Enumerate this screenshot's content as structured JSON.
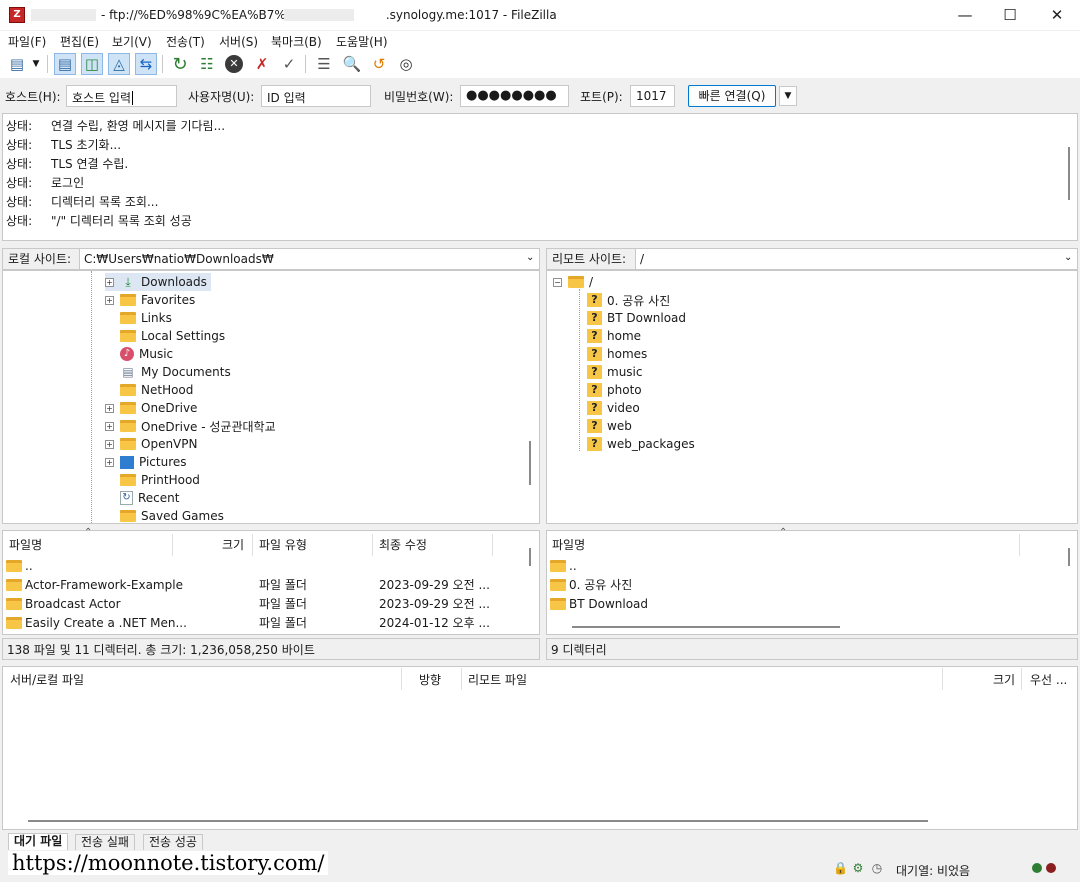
{
  "window": {
    "title": "- ftp://%ED%98%9C%EA%B7%9C@",
    "title_suffix": ".synology.me:1017 - FileZilla",
    "minimize_icon": "minimize-icon",
    "maximize_icon": "maximize-icon",
    "close_icon": "close-icon"
  },
  "menu": [
    "파일(F)",
    "편집(E)",
    "보기(V)",
    "전송(T)",
    "서버(S)",
    "북마크(B)",
    "도움말(H)"
  ],
  "toolbar_icons": [
    "site-manager-icon",
    "dropdown-icon",
    "toggle-log-icon",
    "toggle-local-tree-icon",
    "toggle-remote-tree-icon",
    "toggle-queue-icon",
    "refresh-icon",
    "process-queue-icon",
    "cancel-icon",
    "disconnect-icon",
    "reconnect-icon",
    "filter-icon",
    "compare-icon",
    "sync-browse-icon",
    "search-icon"
  ],
  "quickconnect": {
    "host_label": "호스트(H):",
    "host_value": "호스트 입력",
    "user_label": "사용자명(U):",
    "user_value": "ID 입력",
    "pass_label": "비밀번호(W):",
    "pass_value": "●●●●●●●●",
    "port_label": "포트(P):",
    "port_value": "1017",
    "connect_label": "빠른 연결(Q)"
  },
  "log": [
    {
      "label": "상태:",
      "text": "연결 수립, 환영 메시지를 기다림..."
    },
    {
      "label": "상태:",
      "text": "TLS 초기화..."
    },
    {
      "label": "상태:",
      "text": "TLS 연결 수립."
    },
    {
      "label": "상태:",
      "text": "로그인"
    },
    {
      "label": "상태:",
      "text": "디렉터리 목록 조회..."
    },
    {
      "label": "상태:",
      "text": "\"/\" 디렉터리 목록 조회 성공"
    }
  ],
  "local": {
    "site_label": "로컬 사이트:",
    "path": "C:₩Users₩natio₩Downloads₩",
    "tree": [
      {
        "name": "Downloads",
        "icon": "download-icon",
        "expand": true
      },
      {
        "name": "Favorites",
        "icon": "folder-icon",
        "expand": true
      },
      {
        "name": "Links",
        "icon": "folder-icon",
        "expand": false
      },
      {
        "name": "Local Settings",
        "icon": "folder-icon",
        "expand": false
      },
      {
        "name": "Music",
        "icon": "music-icon",
        "expand": false
      },
      {
        "name": "My Documents",
        "icon": "document-icon",
        "expand": false
      },
      {
        "name": "NetHood",
        "icon": "folder-icon",
        "expand": false
      },
      {
        "name": "OneDrive",
        "icon": "folder-icon",
        "expand": true
      },
      {
        "name": "OneDrive - 성균관대학교",
        "icon": "folder-icon",
        "expand": true
      },
      {
        "name": "OpenVPN",
        "icon": "folder-icon",
        "expand": true
      },
      {
        "name": "Pictures",
        "icon": "pictures-icon",
        "expand": true
      },
      {
        "name": "PrintHood",
        "icon": "folder-icon",
        "expand": false
      },
      {
        "name": "Recent",
        "icon": "recent-icon",
        "expand": false
      },
      {
        "name": "Saved Games",
        "icon": "folder-icon",
        "expand": false
      }
    ],
    "columns": [
      "파일명",
      "크기",
      "파일 유형",
      "최종 수정"
    ],
    "rows": [
      {
        "name": "..",
        "size": "",
        "type": "",
        "modified": ""
      },
      {
        "name": "Actor-Framework-Example",
        "size": "",
        "type": "파일 폴더",
        "modified": "2023-09-29 오전 ..."
      },
      {
        "name": "Broadcast Actor",
        "size": "",
        "type": "파일 폴더",
        "modified": "2023-09-29 오전 ..."
      },
      {
        "name": "Easily Create a .NET Men...",
        "size": "",
        "type": "파일 폴더",
        "modified": "2024-01-12 오후 ..."
      }
    ],
    "status": "138 파일 및 11 디렉터리. 총 크기: 1,236,058,250 바이트"
  },
  "remote": {
    "site_label": "리모트 사이트:",
    "path": "/",
    "root": "/",
    "tree": [
      "0. 공유 사진",
      "BT Download",
      "home",
      "homes",
      "music",
      "photo",
      "video",
      "web",
      "web_packages"
    ],
    "columns": [
      "파일명"
    ],
    "rows": [
      "..",
      "0. 공유 사진",
      "BT Download"
    ],
    "status": "9 디렉터리"
  },
  "queue": {
    "columns": [
      "서버/로컬 파일",
      "방향",
      "리모트 파일",
      "크기",
      "우선 ..."
    ],
    "tabs": [
      "대기 파일",
      "전송 실패",
      "전송 성공"
    ]
  },
  "statusbar": {
    "queue_text": "대기열: 비었음"
  },
  "watermark": "https://moonnote.tistory.com/"
}
